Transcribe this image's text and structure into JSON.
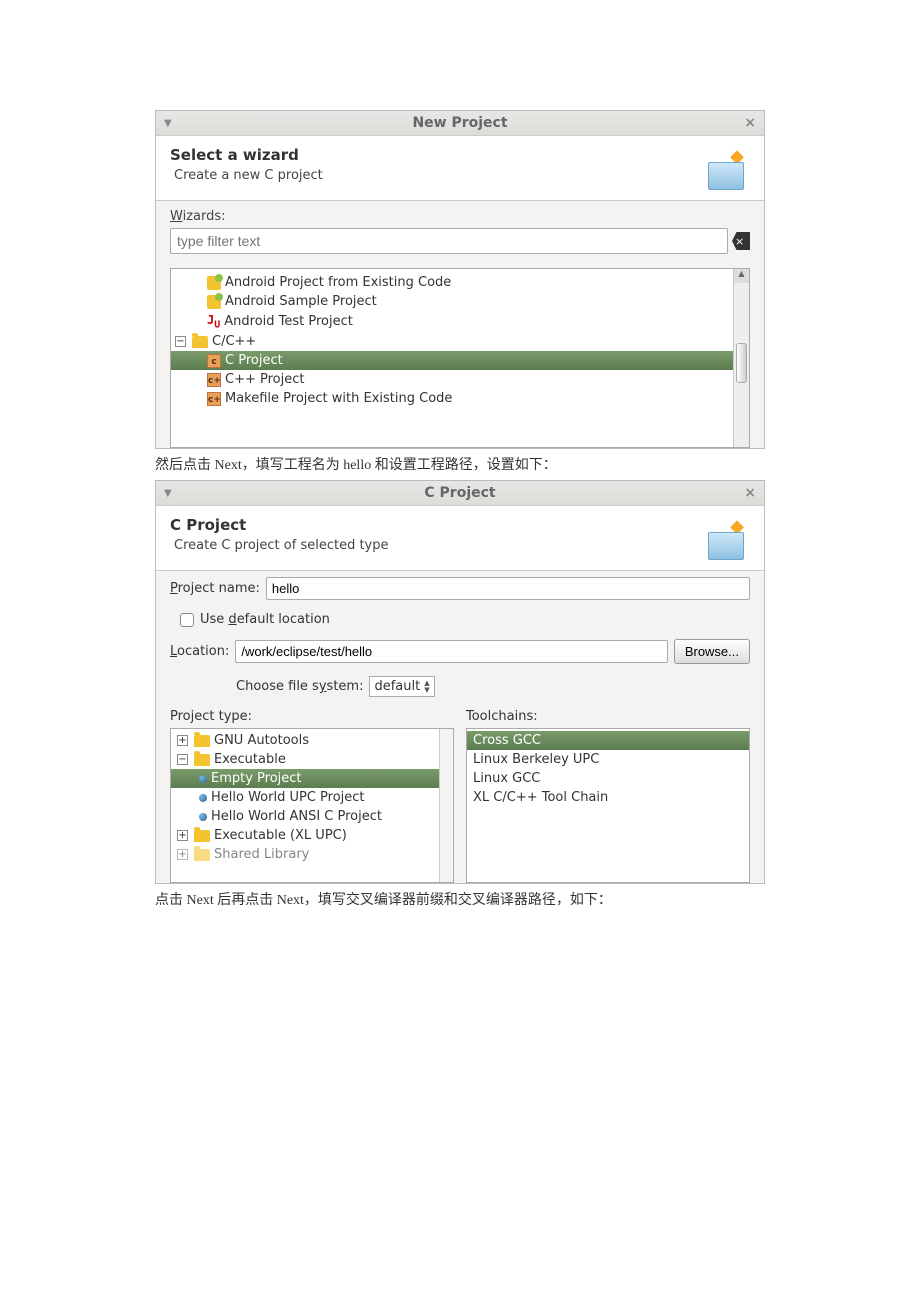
{
  "dialog1": {
    "title": "New Project",
    "banner_title": "Select a wizard",
    "banner_subtitle": "Create a new C project",
    "wizards_label": "Wizards:",
    "filter_placeholder": "type filter text",
    "tree": {
      "item_android_existing": "Android Project from Existing Code",
      "item_android_sample": "Android Sample Project",
      "item_android_test": "Android Test Project",
      "item_cc_folder": "C/C++",
      "item_c_project": "C Project",
      "item_cpp_project": "C++ Project",
      "item_makefile": "Makefile Project with Existing Code"
    }
  },
  "text1": "然后点击 Next，填写工程名为 hello 和设置工程路径，设置如下：",
  "dialog2": {
    "title": "C Project",
    "banner_title": "C Project",
    "banner_subtitle": "Create C project of selected type",
    "project_name_label": "Project name:",
    "project_name_value": "hello",
    "use_default_label": "Use default location",
    "location_label": "Location:",
    "location_value": "/work/eclipse/test/hello",
    "browse_button": "Browse...",
    "choose_fs_label": "Choose file system:",
    "choose_fs_value": "default",
    "project_type_label": "Project type:",
    "toolchains_label": "Toolchains:",
    "types": {
      "gnu_autotools": "GNU Autotools",
      "executable": "Executable",
      "empty_project": "Empty Project",
      "hello_upc": "Hello World UPC Project",
      "hello_ansi": "Hello World ANSI C Project",
      "executable_xl": "Executable (XL UPC)",
      "shared_lib": "Shared Library"
    },
    "toolchains": {
      "cross_gcc": "Cross GCC",
      "linux_berkeley": "Linux Berkeley UPC",
      "linux_gcc": "Linux GCC",
      "xl_toolchain": "XL C/C++ Tool Chain"
    }
  },
  "text2": "点击 Next 后再点击 Next，填写交叉编译器前缀和交叉编译器路径，如下："
}
